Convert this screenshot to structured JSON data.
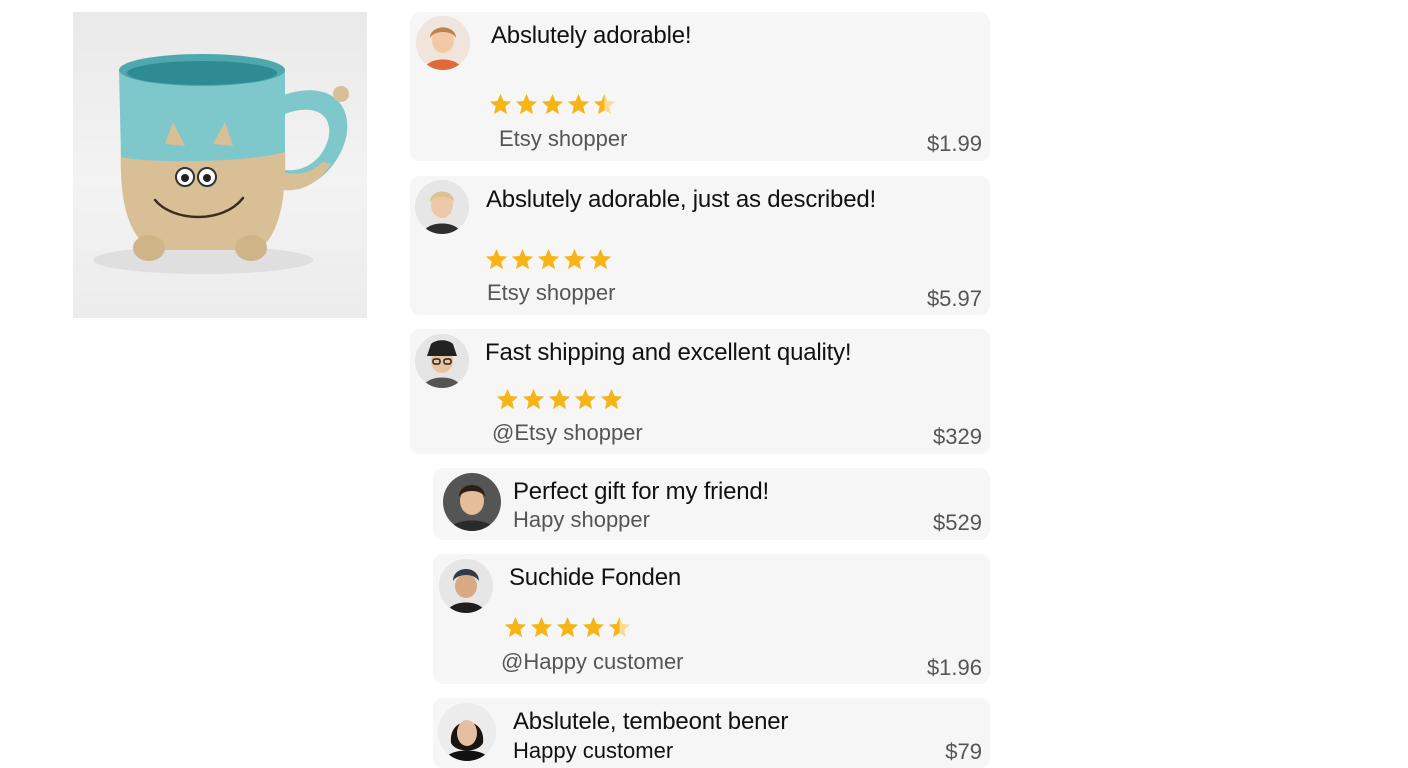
{
  "product": {
    "icon": "smiling-creature-mug"
  },
  "colors": {
    "star": "#f6b417",
    "card_bg": "#f6f6f6",
    "mug_glaze": "#7ec8cc",
    "mug_clay": "#d8bf95"
  },
  "reviews": [
    {
      "title": "Abslutely adorable!",
      "rating": 4.5,
      "shopper": "Etsy shopper",
      "price": "$1.99"
    },
    {
      "title": "Abslutely adorable, just as described!",
      "rating": 5,
      "shopper": "Etsy shopper",
      "price": "$5.97"
    },
    {
      "title": "Fast shipping and excellent quality!",
      "rating": 5,
      "shopper": "@Etsy shopper",
      "price": "$329"
    },
    {
      "title": "Perfect gift for my friend!",
      "rating": null,
      "shopper": "Hapy shopper",
      "price": "$529"
    },
    {
      "title": "Suchide Fonden",
      "rating": 4.5,
      "shopper": "@Happy customer",
      "price": "$1.96"
    },
    {
      "title": "Abslutele, tembeont bener",
      "rating": null,
      "shopper": "Happy customer",
      "price": "$79"
    }
  ]
}
